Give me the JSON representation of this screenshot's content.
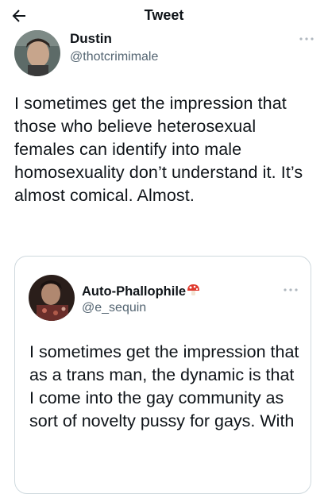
{
  "header": {
    "title": "Tweet",
    "back_icon": "arrow-left-icon"
  },
  "tweet": {
    "author": {
      "display_name": "Dustin",
      "handle": "@thotcrimimale"
    },
    "more_icon": "more-horizontal-icon",
    "text": "I sometimes get the impression that those who believe heterosexual females can identify into male homosexuality don’t understand it. It’s almost comical. Almost."
  },
  "quote": {
    "author": {
      "display_name": "Auto-Phallophile",
      "emoji_icon": "mushroom-emoji-icon",
      "handle": "@e_sequin"
    },
    "more_icon": "more-horizontal-icon",
    "text": "I sometimes get the impression that as a trans man, the dynamic is that I come into the gay community as sort of novelty pussy for gays. With"
  },
  "colors": {
    "text_primary": "#0f1419",
    "text_secondary": "#536471",
    "border": "#cfd9de"
  }
}
